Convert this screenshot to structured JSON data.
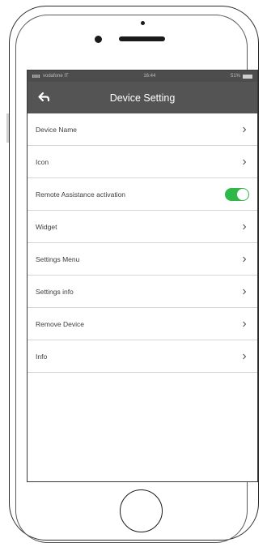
{
  "status_bar": {
    "carrier": "vodafone IT",
    "time": "16:44",
    "battery": "51%"
  },
  "header": {
    "title": "Device Setting"
  },
  "menu": {
    "items": [
      {
        "label": "Device Name",
        "control": "chevron-right-icon"
      },
      {
        "label": "Icon",
        "control": "chevron-right-icon"
      },
      {
        "label": "Remote Assistance activation",
        "control": "toggle",
        "toggle_on": true
      },
      {
        "label": "Widget",
        "control": "chevron-right-icon"
      },
      {
        "label": "Settings Menu",
        "control": "chevron-right-icon"
      },
      {
        "label": "Settings info",
        "control": "chevron-right-icon"
      },
      {
        "label": "Remove Device",
        "control": "chevron-right-icon"
      },
      {
        "label": "Info",
        "control": "chevron-right-icon"
      }
    ]
  },
  "colors": {
    "nav_bar": "#545454",
    "status_bar": "#4d4d4d",
    "toggle_on": "#2fb84a",
    "text": "#3d3d3d"
  }
}
